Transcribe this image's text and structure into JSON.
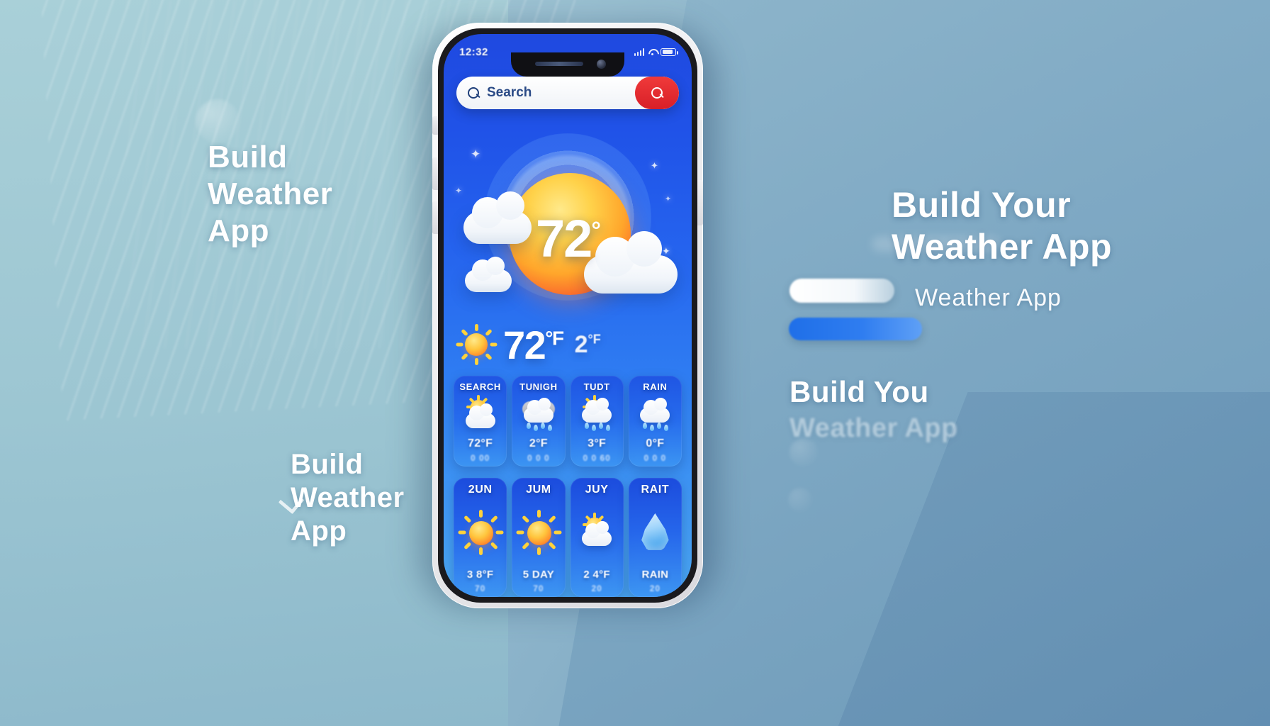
{
  "background": {
    "left_heading": "Build\nWeather\nApp",
    "bottom_heading": "Build\nWeather\nApp",
    "right_heading": "Build Your\nWeather App",
    "right_subtitle": "Weather App",
    "right_mid_heading": "Build You",
    "right_mid_ghost": "Weather App",
    "accent_color": "#2563ee",
    "sky_color": "#9cc3d0"
  },
  "phone": {
    "status": {
      "time": "12:32",
      "signal_icon": "signal-bars-icon",
      "wifi_icon": "wifi-icon",
      "battery_icon": "battery-icon"
    },
    "search": {
      "placeholder": "Search",
      "value": "Search",
      "icon": "search-icon",
      "button_icon": "search-icon",
      "button_color": "#e02a2f"
    },
    "hero": {
      "temperature": "72",
      "degree": "°",
      "sun_icon": "sun-icon",
      "cloud_icons": [
        "cloud-icon",
        "cloud-icon",
        "cloud-icon"
      ],
      "sparkle_icons": [
        "sparkle-icon",
        "sparkle-icon",
        "sparkle-icon",
        "sparkle-icon",
        "sparkle-icon"
      ]
    },
    "current": {
      "icon": "sun-icon",
      "temperature": "72",
      "unit": "°F",
      "secondary_temperature": "2",
      "secondary_unit": "°F"
    },
    "hourly": {
      "cards": [
        {
          "label": "SEARCH",
          "icon": "sun-cloud-icon",
          "value": "72°F",
          "sub": "0 00"
        },
        {
          "label": "TUNIGH",
          "icon": "cloud-rain-icon",
          "value": "2°F",
          "sub": "0 0 0"
        },
        {
          "label": "TUDT",
          "icon": "sun-rain-icon",
          "value": "3°F",
          "sub": "0 0 60"
        },
        {
          "label": "RAIN",
          "icon": "rain-cloud-icon",
          "value": "0°F",
          "sub": "0 0 0"
        }
      ]
    },
    "daily": {
      "cards": [
        {
          "label": "2UN",
          "icon": "sun-icon",
          "value": "3 8°F",
          "sub": "70"
        },
        {
          "label": "JUM",
          "icon": "sun-icon",
          "value": "5 DAY",
          "sub": "70"
        },
        {
          "label": "JUY",
          "icon": "sun-cloud-icon",
          "value": "2 4°F",
          "sub": "20"
        },
        {
          "label": "RAIT",
          "icon": "water-drop-icon",
          "value": "RAIN",
          "sub": "20"
        }
      ]
    }
  }
}
